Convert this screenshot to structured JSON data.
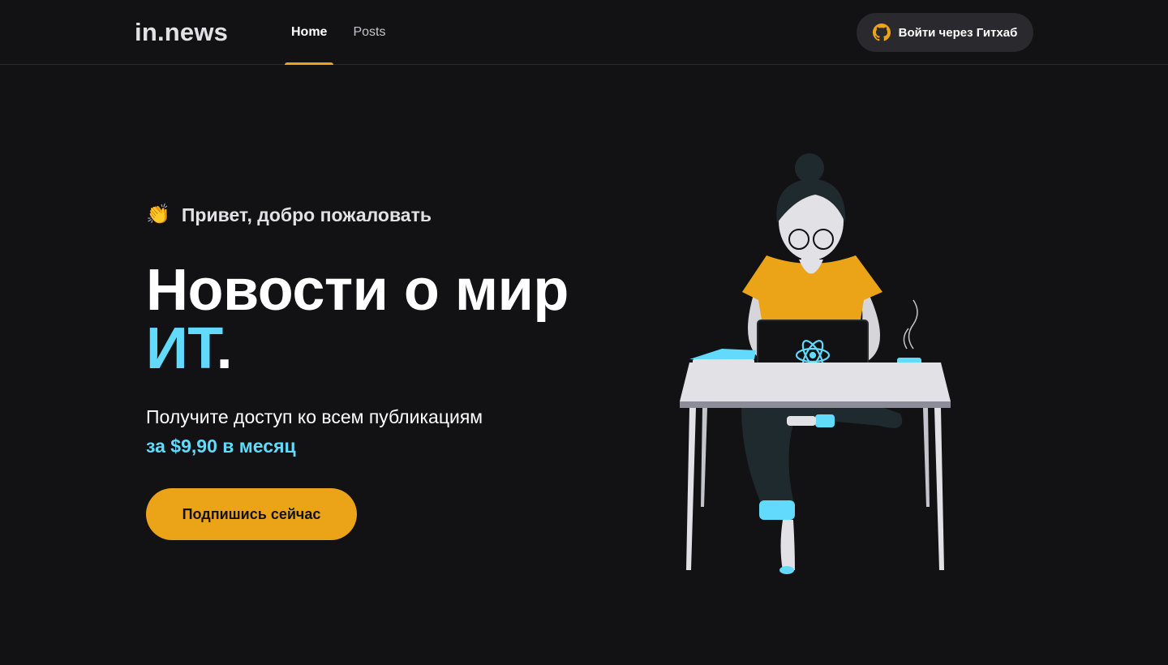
{
  "header": {
    "logo": "in.news",
    "nav": [
      {
        "label": "Home",
        "active": true
      },
      {
        "label": "Posts",
        "active": false
      }
    ],
    "signin_label": "Войти через Гитхаб",
    "signin_icon": "github-icon"
  },
  "hero": {
    "greeting_icon": "clapping-hands-icon",
    "greeting": "Привет, добро пожаловать",
    "title_line1": "Новости о мир",
    "title_accent": "ИТ",
    "title_dot": ".",
    "lead": "Получите доступ ко всем публикациям",
    "price": "за $9,90 в месяц",
    "cta_label": "Подпишись сейчас"
  },
  "illustration": {
    "icon": "woman-at-laptop-illustration",
    "laptop_logo": "react-logo-icon"
  },
  "colors": {
    "background": "#121214",
    "accent_yellow": "#eba417",
    "accent_cyan": "#61dafb",
    "button_dark": "#29292e"
  }
}
